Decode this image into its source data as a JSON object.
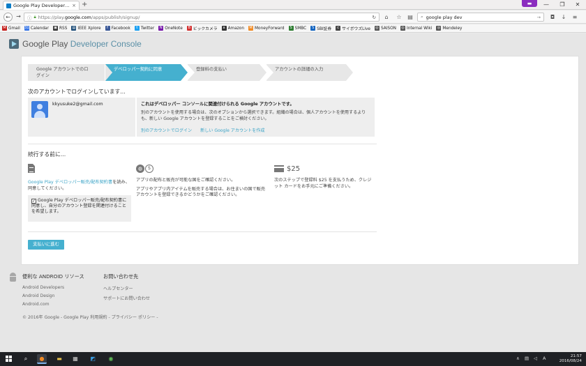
{
  "browser": {
    "tab_title": "Google Play Developer Co...",
    "tab_close": "×",
    "new_tab": "+",
    "url_prefix": "https://play.",
    "url_host": "google.com",
    "url_path": "/apps/publish/signup/",
    "search_text": "google play dev",
    "bookmarks": [
      {
        "label": "Gmail",
        "color": "#c5221f",
        "glyph": "M"
      },
      {
        "label": "Calendar",
        "color": "#3b78e7",
        "glyph": "31"
      },
      {
        "label": "RSS",
        "color": "#333333",
        "glyph": "▣"
      },
      {
        "label": "IEEE Xplore",
        "color": "#1f4e79",
        "glyph": "▤"
      },
      {
        "label": "Facebook",
        "color": "#3b5998",
        "glyph": "f"
      },
      {
        "label": "Twitter",
        "color": "#1da1f2",
        "glyph": "t"
      },
      {
        "label": "OneNote",
        "color": "#7719aa",
        "glyph": "N"
      },
      {
        "label": "ビックカメラ",
        "color": "#d32f2f",
        "glyph": "B"
      },
      {
        "label": "Amazon",
        "color": "#333333",
        "glyph": "a"
      },
      {
        "label": "MoneyForward",
        "color": "#f08a24",
        "glyph": "M"
      },
      {
        "label": "SMBC",
        "color": "#2e7d32",
        "glyph": "S"
      },
      {
        "label": "SBI証券",
        "color": "#1565c0",
        "glyph": "S"
      },
      {
        "label": "サイボウズLive",
        "color": "#444444",
        "glyph": "c"
      },
      {
        "label": "SAISON",
        "color": "#555555",
        "glyph": "◎"
      },
      {
        "label": "Internal Wiki",
        "color": "#555555",
        "glyph": "◎"
      },
      {
        "label": "Mendeley",
        "color": "#555555",
        "glyph": "◎"
      }
    ]
  },
  "header": {
    "brand_google_play": "Google Play",
    "brand_console": "Developer Console"
  },
  "steps": [
    {
      "label": "Google アカウントでのロ\nグイン",
      "active": false
    },
    {
      "label": "デベロッパー契約に同意",
      "active": true
    },
    {
      "label": "登録料の支払い",
      "active": false
    },
    {
      "label": "アカウントの詳細の入力",
      "active": false
    }
  ],
  "login": {
    "title": "次のアカウントでログインしています...",
    "email": "kkyusuke2@gmail.com",
    "heading": "これはデベロッパー コンソールに関連付けられる Google アカウントです。",
    "body": "別のアカウントを使用する場合は、次のオプションから選択できます。組織の場合は、個人アカウントを使用するよりも、新しい Google アカウントを登録することをご検討ください。",
    "link_other": "別のアカウントでログイン",
    "link_new": "新しい Google アカウントを作成"
  },
  "before": {
    "title": "続行する前に...",
    "col1_link": "Google Play デベロッパー販売/配布契約書",
    "col1_text": "を読み、同意してください。",
    "checkbox_text": "Google Play デベロッパー販売/配布契約書に同意し、自分のアカウント登録を関連付けることを希望します。",
    "checkbox_checked": "✓",
    "col2_text1": "アプリの配布と販売が可能な国をご確認ください。",
    "col2_text2": "アプリやアプリ内アイテムを販売する場合は、お住まいの国で販売アカウントを登録できるかどうかをご確認ください。",
    "col3_amount": "$25",
    "col3_text": "次のステップで登録料 $25 を支払うため、クレジット カードをお手元にご準備ください。",
    "pay_button": "支払いに進む"
  },
  "footer": {
    "resources_title": "便利な ANDROID リソース",
    "resources": [
      "Android Developers",
      "Android Design",
      "Android.com"
    ],
    "contact_title": "お問い合わせ先",
    "contact": [
      "ヘルプセンター",
      "サポートにお問い合わせ"
    ],
    "copyright": "© 2016年 Google - Google Play 利用規約 - プライバシー ポリシー -"
  },
  "taskbar": {
    "time": "21:57",
    "date": "2016/08/24"
  }
}
